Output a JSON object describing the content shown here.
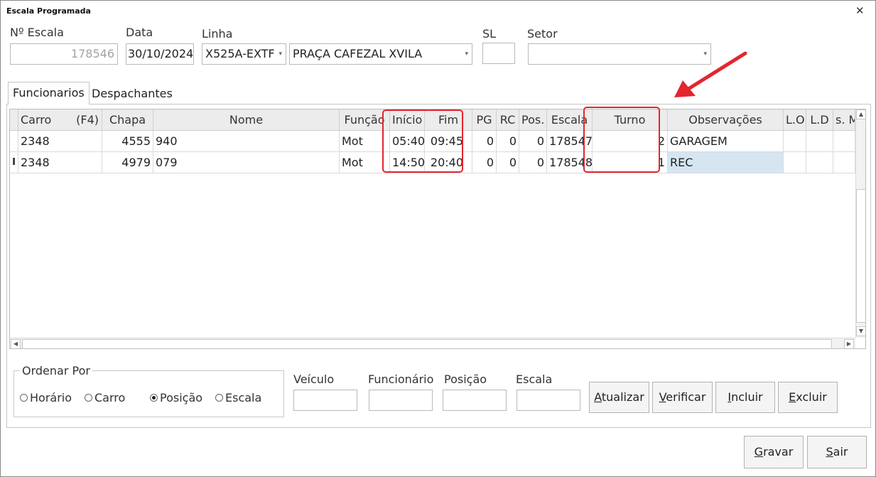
{
  "window": {
    "title": "Escala Programada",
    "close_glyph": "✕"
  },
  "header": {
    "nescala_label": "Nº Escala",
    "nescala_value": "178546",
    "data_label": "Data",
    "data_value": "30/10/2024",
    "linha_label": "Linha",
    "linha_code": "X525A-EXTF",
    "linha_name": "PRAÇA CAFEZAL XVILA",
    "sl_label": "SL",
    "sl_value": "",
    "setor_label": "Setor",
    "setor_value": ""
  },
  "tabs": [
    {
      "label": "Funcionarios",
      "active": true
    },
    {
      "label": "Despachantes",
      "active": false
    }
  ],
  "grid": {
    "columns": [
      "Carro",
      "(F4)",
      "Chapa",
      "Nome",
      "Função",
      "Início",
      "Fim",
      "PG",
      "RC",
      "Pos.",
      "Escala",
      "Turno",
      "Observações",
      "L.O",
      "L.D",
      "s. Mo"
    ],
    "row_indicator": "I",
    "rows": [
      {
        "carro": "2348",
        "chapa": "4555",
        "nome": "940",
        "funcao": "Mot",
        "inicio": "05:40",
        "fim": "09:45",
        "pg": "0",
        "rc": "0",
        "pos": "0",
        "escala": "178547",
        "turno": "2",
        "obs": "GARAGEM",
        "lo": "",
        "ld": "",
        "smo": ""
      },
      {
        "carro": "2348",
        "chapa": "4979",
        "nome": "079",
        "funcao": "Mot",
        "inicio": "14:50",
        "fim": "20:40",
        "pg": "0",
        "rc": "0",
        "pos": "0",
        "escala": "178548",
        "turno": "1",
        "obs": "REC",
        "lo": "",
        "ld": "",
        "smo": ""
      }
    ]
  },
  "ordenar": {
    "title": "Ordenar Por",
    "options": [
      "Horário",
      "Carro",
      "Posição",
      "Escala"
    ],
    "selected": "Posição"
  },
  "filters": {
    "veiculo_label": "Veículo",
    "veiculo_value": "",
    "funcionario_label": "Funcionário",
    "funcionario_value": "",
    "posicao_label": "Posição",
    "posicao_value": "",
    "escala_label": "Escala",
    "escala_value": ""
  },
  "buttons": {
    "atualizar_first": "A",
    "atualizar_rest": "tualizar",
    "verificar_first": "V",
    "verificar_rest": "erificar",
    "incluir_first": "I",
    "incluir_rest": "ncluir",
    "excluir_first": "E",
    "excluir_rest": "xcluir",
    "gravar_first": "G",
    "gravar_rest": "ravar",
    "sair_first": "S",
    "sair_rest": "air"
  },
  "colors": {
    "annotation": "#e3262f",
    "selection": "#d5e6f2",
    "header_bg": "#ececec"
  },
  "icons": {
    "combo_arrow": "chevron-down-icon",
    "close": "close-icon",
    "annotation": "red-arrow-icon"
  }
}
